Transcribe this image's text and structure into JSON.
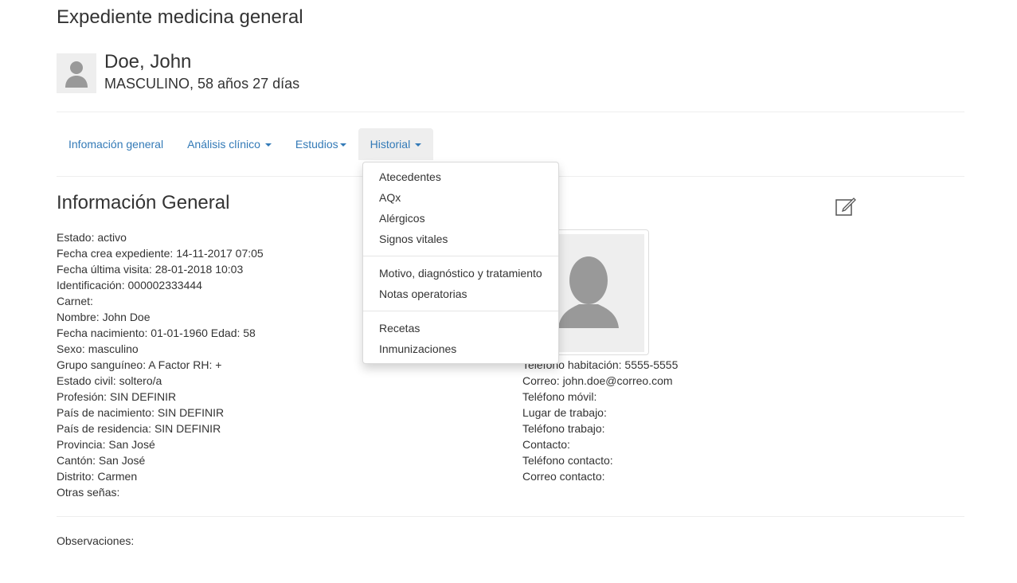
{
  "page": {
    "title": "Expediente medicina general"
  },
  "patient": {
    "name": "Doe, John",
    "summary": "MASCULINO, 58 años 27 días",
    "avatar_icon": "user-silhouette-icon"
  },
  "nav": {
    "items": [
      {
        "label": "Infomación general",
        "has_caret": false
      },
      {
        "label": "Análisis clínico",
        "has_caret": true
      },
      {
        "label": "Estudios",
        "has_caret": true
      },
      {
        "label": "Historial",
        "has_caret": true,
        "active": true
      }
    ]
  },
  "dropdown": {
    "groups": [
      [
        "Atecedentes",
        "AQx",
        "Alérgicos",
        "Signos vitales"
      ],
      [
        "Motivo, diagnóstico y tratamiento",
        "Notas operatorias"
      ],
      [
        "Recetas",
        "Inmunizaciones"
      ]
    ]
  },
  "section": {
    "title": "Información General",
    "edit_icon": "edit-icon"
  },
  "info_left": [
    "Estado: activo",
    "Fecha crea expediente: 14-11-2017 07:05",
    "Fecha última visita: 28-01-2018 10:03",
    "Identificación: 000002333444",
    "Carnet:",
    "Nombre: John Doe",
    "Fecha nacimiento: 01-01-1960 Edad: 58",
    "Sexo: masculino",
    "Grupo sanguíneo: A Factor RH: +",
    "Estado civil: soltero/a",
    "Profesión: SIN DEFINIR",
    "País de nacimiento: SIN DEFINIR",
    "País de residencia: SIN DEFINIR",
    "Provincia: San José",
    "Cantón: San José",
    "Distrito: Carmen",
    "Otras señas:"
  ],
  "info_right": [
    "Teléfono habitación: 5555-5555",
    "Correo: john.doe@correo.com",
    "Teléfono móvil:",
    "Lugar de trabajo:",
    "Teléfono trabajo:",
    "Contacto:",
    "Teléfono contacto:",
    "Correo contacto:"
  ],
  "observaciones": "Observaciones:",
  "colors": {
    "link": "#337ab7",
    "text": "#333333",
    "divider": "#eeeeee",
    "photo_bg": "#eeeeee",
    "silhouette": "#999999"
  }
}
